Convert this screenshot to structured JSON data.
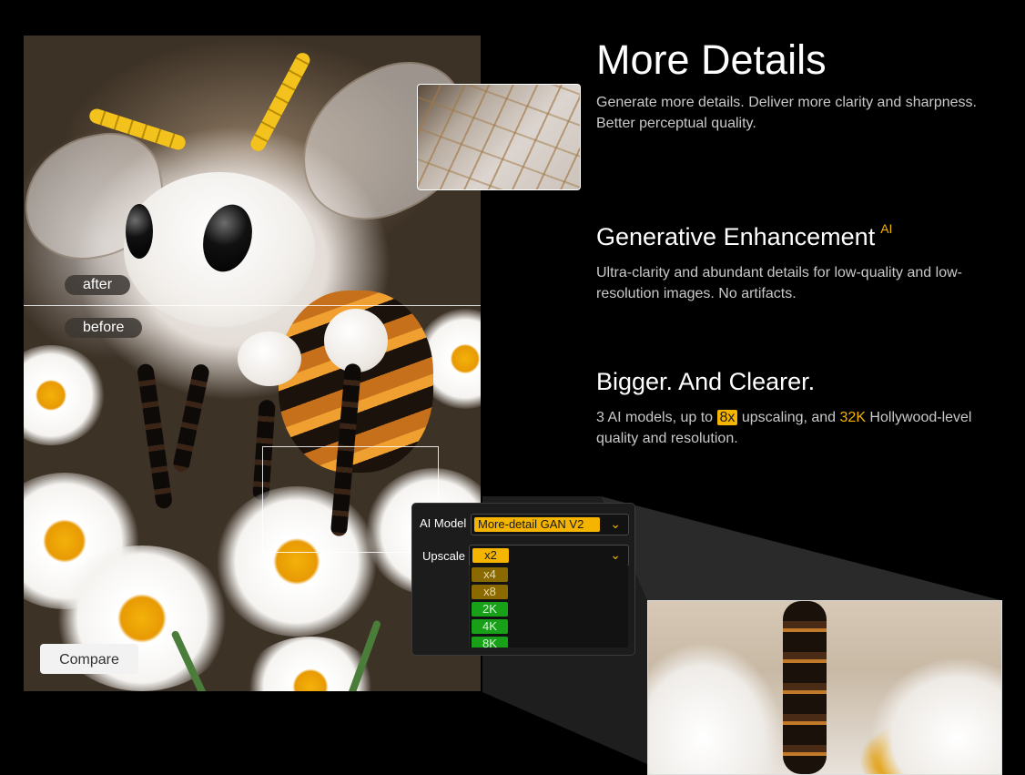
{
  "photo": {
    "tag_after": "after",
    "tag_before": "before",
    "compare_label": "Compare"
  },
  "sections": {
    "more_details": {
      "title": "More Details",
      "description": "Generate more details. Deliver more clarity and sharpness. Better perceptual quality."
    },
    "generative": {
      "title": "Generative Enhancement",
      "badge": "AI",
      "description": "Ultra-clarity and abundant details for low-quality and low-resolution images. No artifacts."
    },
    "bigger": {
      "title": "Bigger. And Clearer.",
      "desc_part1": "3 AI models, up to ",
      "desc_highlight1": "8x",
      "desc_part2": " upscaling, and ",
      "desc_highlight2": "32K",
      "desc_part3": " Hollywood-level quality and resolution."
    }
  },
  "settings": {
    "model_label": "AI Model",
    "model_value": "More-detail GAN V2",
    "upscale_label": "Upscale",
    "upscale_value": "x2",
    "upscale_options": [
      {
        "label": "x4",
        "color": "#8a6a00"
      },
      {
        "label": "x8",
        "color": "#8a6a00"
      },
      {
        "label": "2K",
        "color": "#18a018"
      },
      {
        "label": "4K",
        "color": "#18a018"
      },
      {
        "label": "8K",
        "color": "#18a018"
      }
    ]
  },
  "colors": {
    "accent": "#f5b400",
    "background": "#000000",
    "text_muted": "#c9c9c9"
  }
}
